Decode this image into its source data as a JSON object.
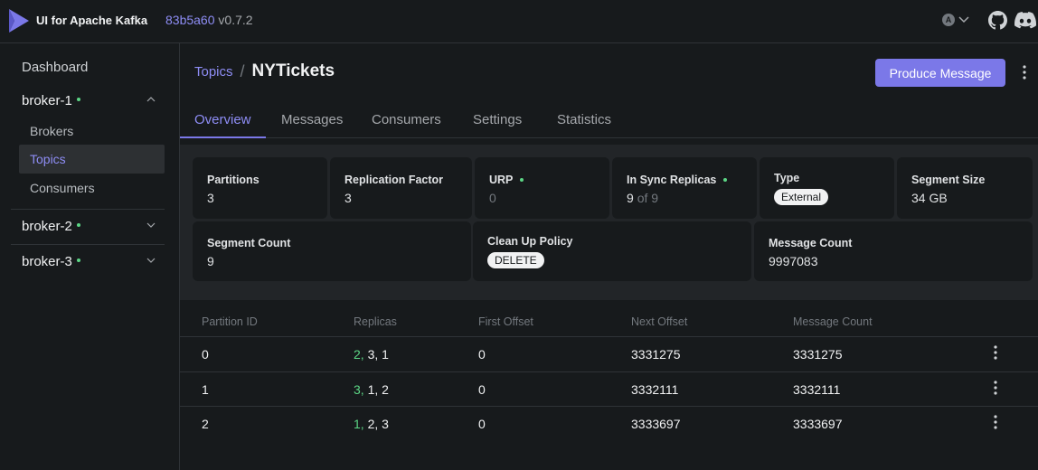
{
  "header": {
    "app_title": "UI for Apache Kafka",
    "version_hash": "83b5a60",
    "version": "v0.7.2",
    "user_initial": "A"
  },
  "sidebar": {
    "dashboard": "Dashboard",
    "clusters": [
      {
        "name": "broker-1",
        "expanded": true,
        "status": "online"
      },
      {
        "name": "broker-2",
        "expanded": false,
        "status": "online"
      },
      {
        "name": "broker-3",
        "expanded": false,
        "status": "online"
      }
    ],
    "sub_items": [
      "Brokers",
      "Topics",
      "Consumers"
    ],
    "active_sub_item": "Topics"
  },
  "breadcrumb": {
    "parent": "Topics",
    "separator": "/",
    "current": "NYTickets"
  },
  "actions": {
    "produce_label": "Produce Message"
  },
  "tabs": [
    {
      "label": "Overview",
      "active": true
    },
    {
      "label": "Messages",
      "active": false
    },
    {
      "label": "Consumers",
      "active": false
    },
    {
      "label": "Settings",
      "active": false
    },
    {
      "label": "Statistics",
      "active": false
    }
  ],
  "stats": {
    "partitions": {
      "label": "Partitions",
      "value": "3"
    },
    "replication_factor": {
      "label": "Replication Factor",
      "value": "3"
    },
    "urp": {
      "label": "URP",
      "value": "0"
    },
    "in_sync": {
      "label": "In Sync Replicas",
      "value": "9",
      "of_text": "of 9"
    },
    "type": {
      "label": "Type",
      "value": "External"
    },
    "segment_size": {
      "label": "Segment Size",
      "value": "34 GB"
    },
    "segment_count": {
      "label": "Segment Count",
      "value": "9"
    },
    "cleanup_policy": {
      "label": "Clean Up Policy",
      "value": "DELETE"
    },
    "message_count": {
      "label": "Message Count",
      "value": "9997083"
    }
  },
  "partitions_table": {
    "columns": [
      "Partition ID",
      "Replicas",
      "First Offset",
      "Next Offset",
      "Message Count"
    ],
    "rows": [
      {
        "id": "0",
        "leader": "2,",
        "replicas_rest": " 3, 1",
        "first_offset": "0",
        "next_offset": "3331275",
        "message_count": "3331275"
      },
      {
        "id": "1",
        "leader": "3,",
        "replicas_rest": " 1, 2",
        "first_offset": "0",
        "next_offset": "3332111",
        "message_count": "3332111"
      },
      {
        "id": "2",
        "leader": "1,",
        "replicas_rest": " 2, 3",
        "first_offset": "0",
        "next_offset": "3333697",
        "message_count": "3333697"
      }
    ]
  },
  "colors": {
    "accent": "#7b78e8",
    "link": "#8e8df5",
    "online": "#5cd685",
    "background": "#171a1c"
  },
  "icons": [
    "kafka-logo-icon",
    "chevron-down-icon",
    "chevron-up-icon",
    "github-icon",
    "discord-icon",
    "kebab-menu-icon"
  ]
}
